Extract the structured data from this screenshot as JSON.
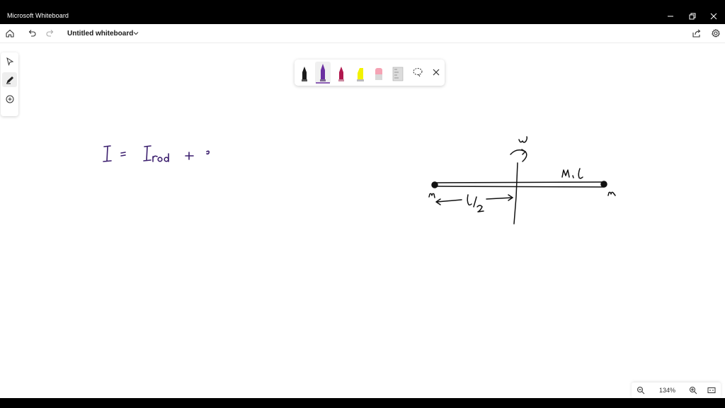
{
  "window": {
    "title": "Microsoft Whiteboard"
  },
  "toolbar": {
    "document_title": "Untitled whiteboard"
  },
  "zoom": {
    "level": "134%"
  },
  "pens": [
    {
      "name": "black-pen",
      "color": "#1a1a1a"
    },
    {
      "name": "purple-pen",
      "color": "#6b2fa0"
    },
    {
      "name": "magenta-pen",
      "color": "#b0174e"
    },
    {
      "name": "yellow-highlighter",
      "color": "#f2f200"
    },
    {
      "name": "pink-eraser",
      "color": "#f5a3b4"
    },
    {
      "name": "ruler",
      "color": "#c8c8c8"
    }
  ],
  "canvas": {
    "ink_color_purple": "#3c1f6e",
    "ink_color_dark": "#111111"
  }
}
